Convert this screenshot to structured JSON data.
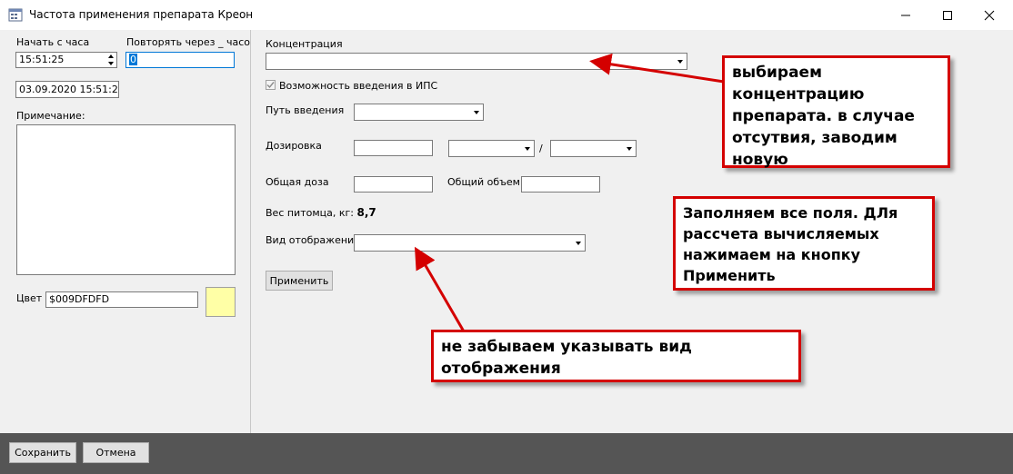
{
  "window": {
    "title": "Частота применения препарата Креон",
    "min_symbol": "—",
    "max_symbol": "☐",
    "close_symbol": "✕"
  },
  "left": {
    "start_label": "Начать с часа",
    "start_value": "15:51:25",
    "repeat_label": "Повторять через _ часов",
    "repeat_value": "0",
    "date_value": "03.09.2020 15:51:2",
    "note_label": "Примечание:",
    "color_label": "Цвет",
    "color_value": "$009DFDFD",
    "color_swatch": "#ffffa6"
  },
  "form": {
    "concentration_label": "Концентрация",
    "ips_label": "Возможность введения в ИПС",
    "ips_checked": true,
    "route_label": "Путь введения",
    "dosage_label": "Дозировка",
    "dosage_separator": "/",
    "total_dose_label": "Общая доза",
    "total_volume_label": "Общий объем",
    "weight_label": "Вес питомца, кг:",
    "weight_value": "8,7",
    "display_label": "Вид отображения",
    "apply_button": "Применить"
  },
  "footer": {
    "save_button": "Сохранить",
    "cancel_button": "Отмена"
  },
  "annotations": {
    "note1": "выбираем концентрацию препарата. в случае отсутвия, заводим новую",
    "note2": "Заполняем все поля. ДЛя рассчета вычисляемых нажимаем на кнопку Применить",
    "note3": "не забываем указывать вид отображения",
    "color": "#d40000"
  }
}
